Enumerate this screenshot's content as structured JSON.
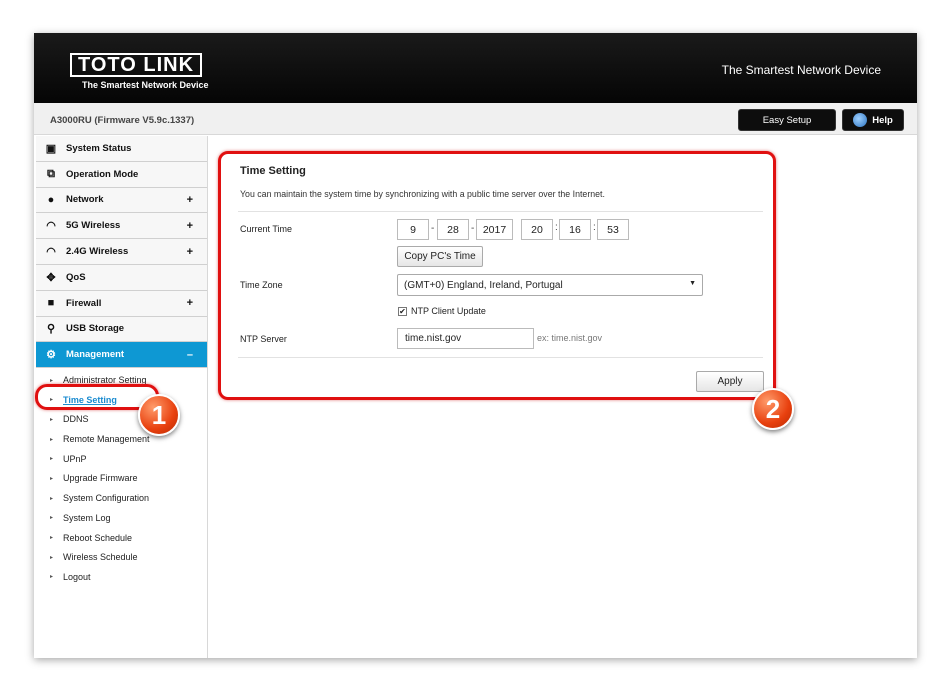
{
  "header": {
    "logo_text": "TOTO LINK",
    "logo_tagline": "The Smartest Network Device",
    "slogan": "The Smartest Network Device"
  },
  "subbar": {
    "model": "A3000RU (Firmware V5.9c.1337)",
    "easy_setup": "Easy Setup",
    "help": "Help"
  },
  "sidebar": {
    "items": [
      {
        "label": "System Status",
        "icon": "chat-icon",
        "expand": ""
      },
      {
        "label": "Operation Mode",
        "icon": "windows-icon",
        "expand": ""
      },
      {
        "label": "Network",
        "icon": "globe-icon",
        "expand": "+"
      },
      {
        "label": "5G Wireless",
        "icon": "wifi-icon",
        "expand": "+"
      },
      {
        "label": "2.4G Wireless",
        "icon": "wifi-icon",
        "expand": "+"
      },
      {
        "label": "QoS",
        "icon": "qos-icon",
        "expand": ""
      },
      {
        "label": "Firewall",
        "icon": "lock-icon",
        "expand": "+"
      },
      {
        "label": "USB Storage",
        "icon": "usb-icon",
        "expand": ""
      },
      {
        "label": "Management",
        "icon": "gear-icon",
        "expand": "–"
      }
    ],
    "sub_items": [
      "Administrator Setting",
      "Time Setting",
      "DDNS",
      "Remote Management",
      "UPnP",
      "Upgrade Firmware",
      "System Configuration",
      "System Log",
      "Reboot Schedule",
      "Wireless Schedule",
      "Logout"
    ]
  },
  "main": {
    "title": "Time Setting",
    "description": "You can maintain the system time by synchronizing with a public time server over the Internet.",
    "current_time_label": "Current Time",
    "time": {
      "month": "9",
      "day": "28",
      "year": "2017",
      "hour": "20",
      "minute": "16",
      "second": "53"
    },
    "sep_date": "-",
    "sep_time": ":",
    "copy_pc_time": "Copy PC's Time",
    "time_zone_label": "Time Zone",
    "time_zone_value": "(GMT+0) England, Ireland, Portugal",
    "ntp_client_update": "NTP Client Update",
    "ntp_checked": "✔",
    "ntp_server_label": "NTP Server",
    "ntp_server_value": "time.nist.gov",
    "ntp_example": "ex: time.nist.gov",
    "apply": "Apply"
  },
  "annotations": {
    "badge1": "1",
    "badge2": "2"
  },
  "colors": {
    "accent": "#0e98d3",
    "highlight": "#e01010",
    "badge": "#e8400e"
  }
}
